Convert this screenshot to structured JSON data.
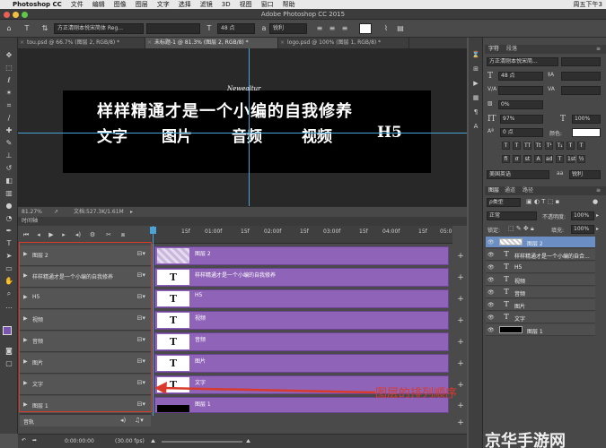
{
  "menubar": {
    "app_name": "Photoshop CC",
    "items": [
      "文件",
      "编辑",
      "图像",
      "图层",
      "文字",
      "选择",
      "滤镜",
      "3D",
      "视图",
      "窗口",
      "帮助"
    ],
    "clock": "周五下午3"
  },
  "window": {
    "title": "Adobe Photoshop CC 2015"
  },
  "options_bar": {
    "font_family": "方正清刚本悦宋简体 Reg...",
    "font_size": "48 点",
    "antialias": "锐利"
  },
  "tabs": [
    {
      "label": "tou.psd @ 66.7% (图层 2, RGB/8) *"
    },
    {
      "label": "未标题-1 @ 81.3% (图层 2, RGB/8) *"
    },
    {
      "label": "logo.psd @ 100% (图层 1, RGB/8) *"
    }
  ],
  "canvas": {
    "headline": "样样精通才是一个小编的自我修养",
    "sub_items": [
      "文字",
      "图片",
      "音频",
      "视频",
      "H5"
    ],
    "watermark": "Newealtur"
  },
  "statusbar": {
    "zoom": "81.27%",
    "doc": "文档:527.3K/1.61M"
  },
  "timeline": {
    "panel_title": "时间轴",
    "ruler": [
      "15f",
      "01:00f",
      "15f",
      "02:00f",
      "15f",
      "03:00f",
      "15f",
      "04:00f",
      "15f",
      "05:0"
    ],
    "tracks": [
      {
        "label": "图层 2",
        "clip": "图层 2"
      },
      {
        "label": "样样精通才是一个小编的自我修养",
        "clip": "样样精通才是一个小编的自我修养"
      },
      {
        "label": "H5",
        "clip": "H5"
      },
      {
        "label": "视频",
        "clip": "视频"
      },
      {
        "label": "音频",
        "clip": "音频"
      },
      {
        "label": "图片",
        "clip": "图片"
      },
      {
        "label": "文字",
        "clip": "文字"
      },
      {
        "label": "图层 1",
        "clip": "图层 1"
      }
    ],
    "audio_label": "音轨",
    "timecode": "0:00:00:00",
    "fps": "(30.00 fps)"
  },
  "annotation": {
    "text": "图层的排列顺序",
    "color": "#d93a2b"
  },
  "character_panel": {
    "tabs": [
      "字符",
      "段落"
    ],
    "font_family": "方正清刚本悦宋简...",
    "font_size": "48 点",
    "leading": "0%",
    "vscale": "97%",
    "hscale": "100%",
    "tracking": "0 点",
    "color_label": "颜色:",
    "language": "美国英语",
    "aa": "锐利",
    "aa_label": "aa"
  },
  "layers_panel": {
    "tabs": [
      "图层",
      "通道",
      "路径"
    ],
    "kind": "ρ类型",
    "blend": "正常",
    "opacity_label": "不透明度:",
    "opacity": "100%",
    "lock_label": "锁定:",
    "fill_label": "填充:",
    "fill": "100%",
    "layers": [
      {
        "name": "图层 2",
        "type": "image",
        "selected": true
      },
      {
        "name": "样样精通才是一个小编的自合...",
        "type": "text",
        "selected": false
      },
      {
        "name": "H5",
        "type": "text",
        "selected": false
      },
      {
        "name": "视频",
        "type": "text",
        "selected": false
      },
      {
        "name": "音频",
        "type": "text",
        "selected": false
      },
      {
        "name": "图片",
        "type": "text",
        "selected": false
      },
      {
        "name": "文字",
        "type": "text",
        "selected": false
      },
      {
        "name": "图层 1",
        "type": "image",
        "selected": false
      }
    ]
  },
  "site_watermark": "京华手游网",
  "colors": {
    "clip": "#8f63b8",
    "selection": "#6b8fc4",
    "guide": "#4aa3d4"
  }
}
